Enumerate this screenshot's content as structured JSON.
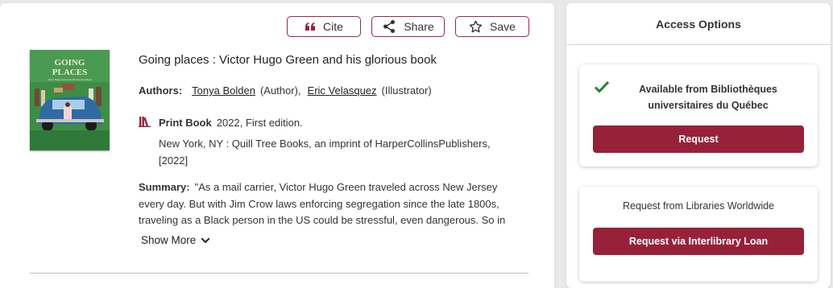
{
  "actions": {
    "cite_label": "Cite",
    "share_label": "Share",
    "save_label": "Save"
  },
  "colors": {
    "brand": "#98213a",
    "check": "#2e7d32"
  },
  "book": {
    "cover": {
      "title_line1": "GOING",
      "title_line2": "PLACES",
      "subtitle": "Victor Hugo Green and His Glorious Book"
    },
    "title": "Going places : Victor Hugo Green and his glorious book",
    "authors_label": "Authors:",
    "authors": [
      {
        "name": "Tonya Bolden",
        "role": "(Author)"
      },
      {
        "name": "Eric Velasquez",
        "role": "(Illustrator)"
      }
    ],
    "format_icon": "books-icon",
    "format": "Print Book",
    "year": "2022,",
    "edition": "First edition.",
    "publisher": "New York, NY : Quill Tree Books, an imprint of HarperCollinsPublishers, [2022]",
    "summary_label": "Summary:",
    "summary": "\"As a mail carrier, Victor Hugo Green traveled across New Jersey every day. But with Jim Crow laws enforcing segregation since the late 1800s, traveling as a Black person in the US could be stressful, even dangerous. So in",
    "show_more": "Show More"
  },
  "access": {
    "title": "Access Options",
    "available_text": "Available from Bibliothèques universitaires du Québec",
    "request_label": "Request",
    "worldwide_text": "Request from Libraries Worldwide",
    "ill_label": "Request via Interlibrary Loan"
  }
}
